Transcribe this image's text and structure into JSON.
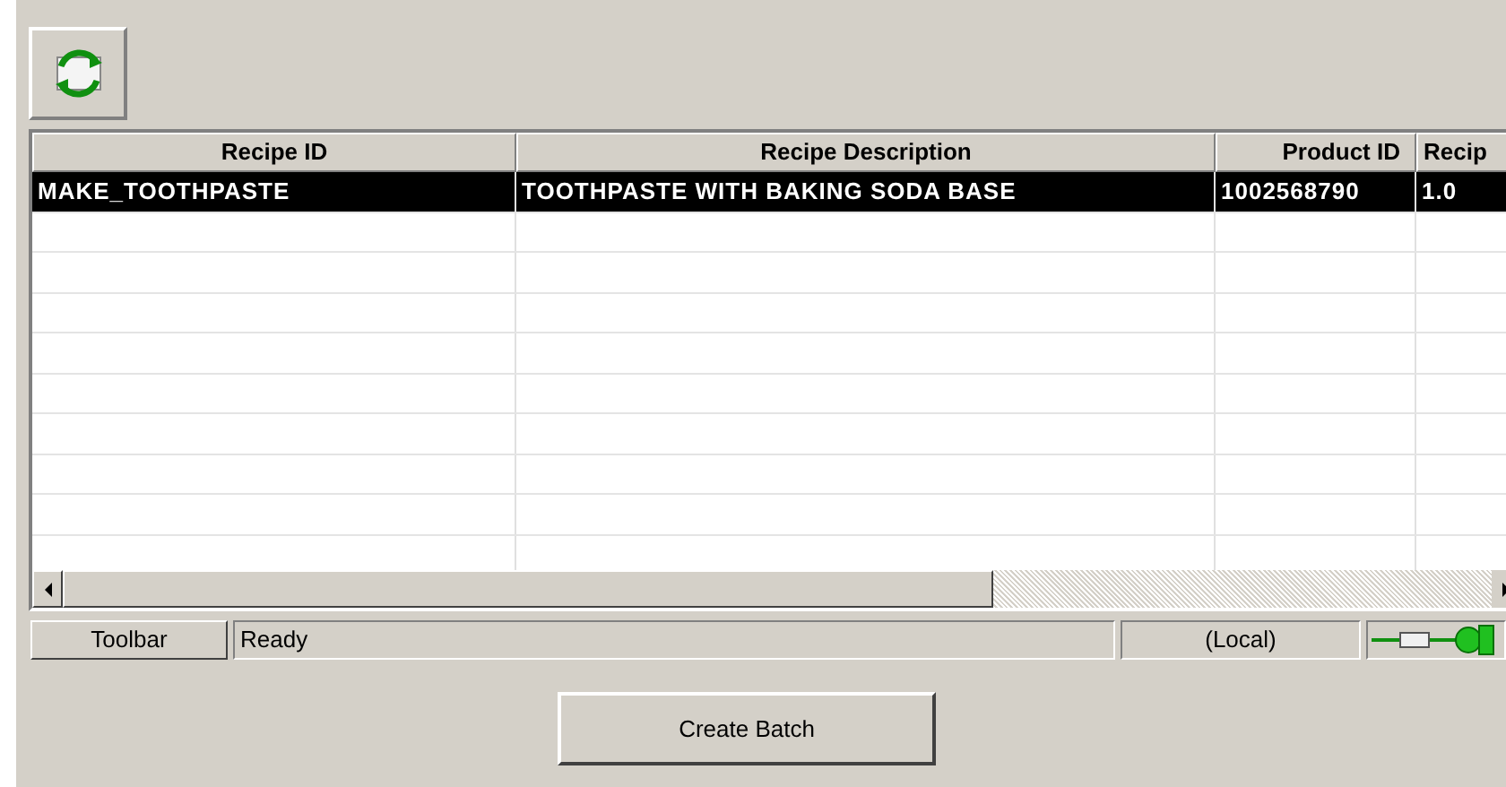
{
  "table": {
    "columns": [
      "Recipe ID",
      "Recipe Description",
      "Product ID",
      "Recip"
    ],
    "rows": [
      {
        "cells": [
          "MAKE_TOOTHPASTE",
          "TOOTHPASTE WITH BAKING SODA BASE",
          "1002568790",
          "1.0"
        ],
        "selected": true
      }
    ]
  },
  "status_bar": {
    "toolbar_button": "Toolbar",
    "message": "Ready",
    "location": "(Local)"
  },
  "buttons": [
    "Create Batch"
  ]
}
